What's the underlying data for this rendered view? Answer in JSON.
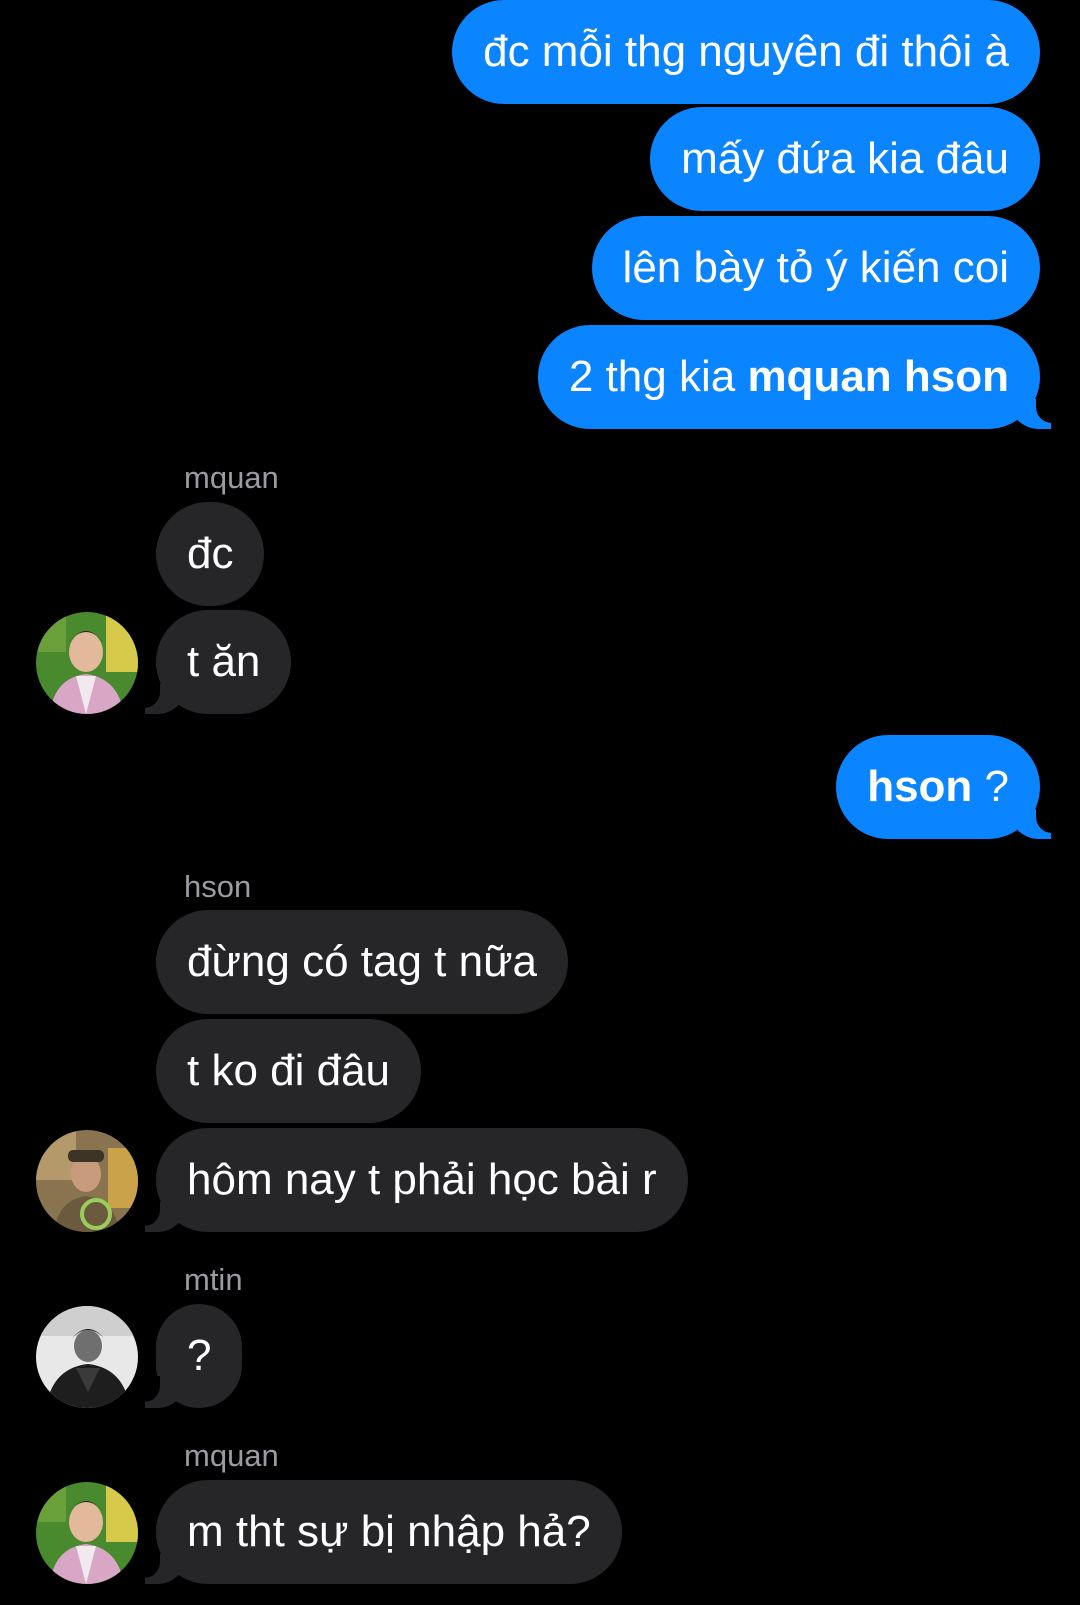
{
  "outgoing": {
    "m1": "đc mỗi thg nguyên đi thôi à",
    "m2": "mấy đứa kia đâu",
    "m3": "lên bày tỏ ý kiến coi",
    "m4_prefix": "2 thg kia ",
    "m4_mention": "mquan hson",
    "m5_mention": "hson",
    "m5_suffix": " ?"
  },
  "group1": {
    "sender": "mquan",
    "messages": [
      "đc",
      "t ăn"
    ],
    "avatar": "avatar-mquan"
  },
  "group2": {
    "sender": "hson",
    "messages": [
      "đừng có tag t nữa",
      "t ko đi đâu",
      "hôm nay t phải học bài r"
    ],
    "avatar": "avatar-hson"
  },
  "group3": {
    "sender": "mtin",
    "messages": [
      "?"
    ],
    "avatar": "avatar-mtin"
  },
  "group4": {
    "sender": "mquan",
    "messages": [
      "m tht sự bị nhập hả?"
    ],
    "avatar": "avatar-mquan"
  },
  "colors": {
    "background": "#000000",
    "outgoing_bubble": "#0a84ff",
    "incoming_bubble": "#262628",
    "sender_name": "#9b9ba1",
    "text": "#ffffff"
  }
}
